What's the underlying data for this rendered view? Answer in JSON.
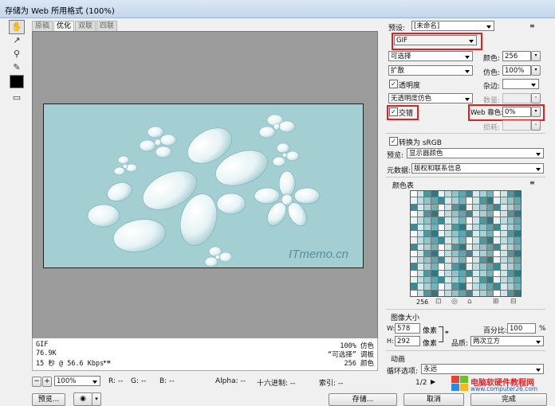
{
  "window": {
    "title": "存储为 Web 所用格式 (100%)"
  },
  "tabs": [
    "原稿",
    "优化",
    "双联",
    "四联"
  ],
  "active_tab": 1,
  "preview": {
    "watermark": "ITmemo.cn",
    "bg_color": "#a3ced2"
  },
  "info": {
    "format": "GIF",
    "size": "76.9K",
    "time": "15 秒 @ 56.6 Kbps",
    "dither_pct": "100% 仿色",
    "palette_label": "“可选择” 调板",
    "colors": "256 颜色"
  },
  "status": {
    "zoom": "100%",
    "r": "R: --",
    "g": "G: --",
    "b": "B: --",
    "alpha": "Alpha: --",
    "hex": "十六进制: --",
    "index": "索引: --"
  },
  "panel": {
    "preset_label": "预设:",
    "preset_value": "[未命名]",
    "format_value": "GIF",
    "reduction_value": "可选择",
    "colors_label": "颜色:",
    "colors_value": "256",
    "dither_algo_value": "扩散",
    "dither_label": "仿色:",
    "dither_value": "100%",
    "transparency_label": "透明度",
    "matte_label": "杂边:",
    "trans_dither_value": "无透明度仿色",
    "amount_label": "数量:",
    "interlaced_label": "交错",
    "web_snap_label": "Web 靠色:",
    "web_snap_value": "0%",
    "lossy_label": "损耗:",
    "convert_srgb_label": "转换为 sRGB",
    "preview_label": "预览:",
    "preview_value": "显示器颜色",
    "metadata_label": "元数据:",
    "metadata_value": "版权和联系信息",
    "color_table_label": "颜色表",
    "color_count": "256"
  },
  "image_size": {
    "section_label": "图像大小",
    "w_label": "W:",
    "w_value": "578",
    "h_label": "H:",
    "h_value": "292",
    "unit": "像素",
    "percent_label": "百分比:",
    "percent_value": "100",
    "percent_unit": "%",
    "quality_label": "品质:",
    "quality_value": "两次立方"
  },
  "animation": {
    "section_label": "动画",
    "loop_label": "循环选项:",
    "loop_value": "永远",
    "frame_counter": "1/2"
  },
  "buttons": {
    "preview": "预览...",
    "save": "存储...",
    "cancel": "取消",
    "done": "完成"
  },
  "overlay_logo": {
    "text": "电脑软硬件教程网",
    "url": "www.computer26.com"
  },
  "accent": {
    "highlight_red": "#d62426",
    "teal": "#a3ced2"
  }
}
